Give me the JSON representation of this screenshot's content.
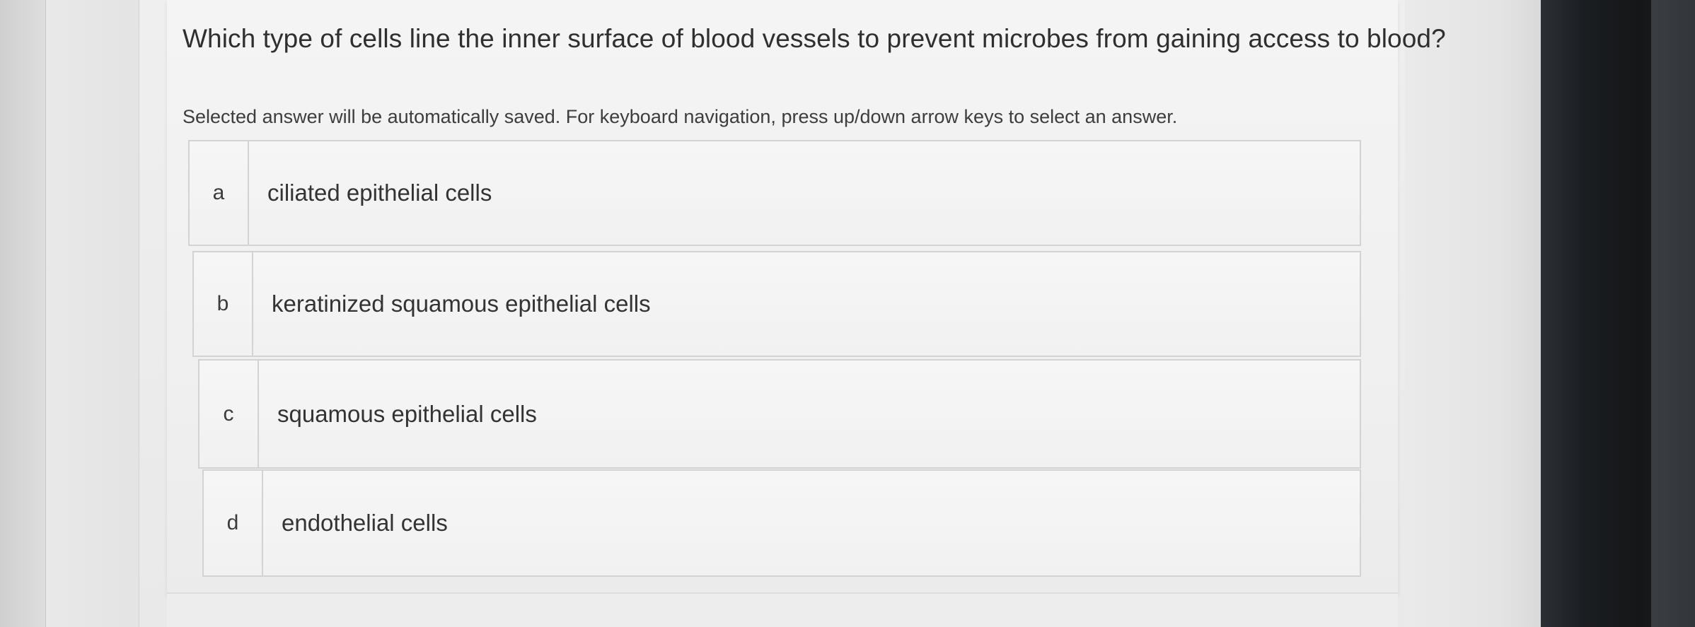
{
  "question": {
    "text": "Which type of cells line the inner surface of blood vessels to prevent microbes from gaining access to blood?",
    "instructions": "Selected answer will be automatically saved. For keyboard navigation, press up/down arrow keys to select an answer."
  },
  "options": [
    {
      "letter": "a",
      "text": "ciliated epithelial cells"
    },
    {
      "letter": "b",
      "text": "keratinized squamous epithelial cells"
    },
    {
      "letter": "c",
      "text": "squamous epithelial cells"
    },
    {
      "letter": "d",
      "text": "endothelial cells"
    }
  ]
}
